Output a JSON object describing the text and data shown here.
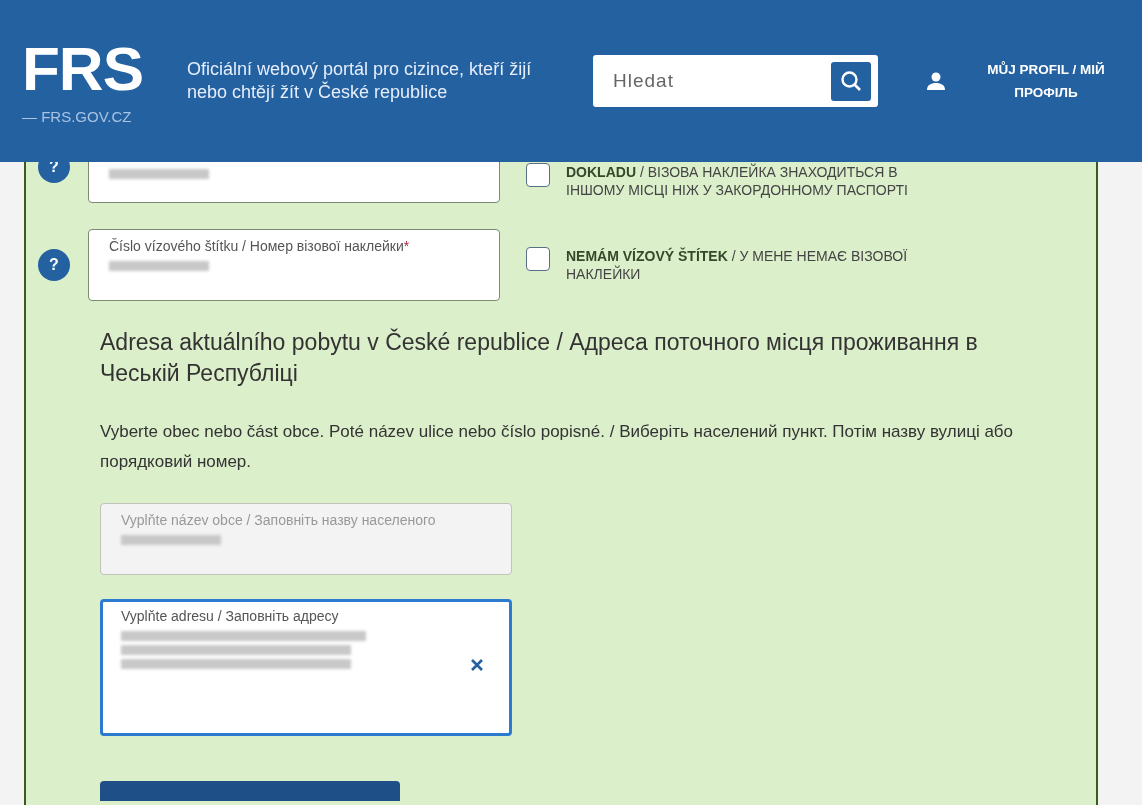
{
  "header": {
    "logo": "FRS",
    "domain": "— FRS.GOV.CZ",
    "tagline": "Oficiální webový portál pro cizince, kteří žijí nebo chtějí žít v České republice",
    "search": {
      "placeholder": "Hledat"
    },
    "profile": "MŮJ PROFIL / МІЙ ПРОФІЛЬ"
  },
  "rows": [
    {
      "help": "?",
      "field": {
        "value_hidden": true,
        "disabled": false,
        "focused": false
      },
      "checkbox": {
        "label": "**DOKLADU** / ВІЗОВА НАКЛЕЙКА ЗНАХОДИТЬСЯ В ІНШОМУ МІСЦІ НІЖ У ЗАКОРДОННОМУ ПАСПОРТІ",
        "checked": false
      }
    },
    {
      "help": "?",
      "field": {
        "label": "Číslo vízového štítku / Номер візової наклейки",
        "required": "*",
        "value_hidden": true,
        "disabled": false,
        "focused": false
      },
      "checkbox": {
        "label": "**NEMÁM VÍZOVÝ ŠTÍTEK** / У МЕНЕ НЕМАЄ ВІЗОВОЇ НАКЛЕЙКИ",
        "checked": false
      }
    }
  ],
  "address": {
    "heading": "Adresa aktuálního pobytu v České republice / Адреса поточного місця проживання в Чеській Республіці",
    "hint": "Vyberte obec nebo část obce. Poté název ulice nebo číslo popisné. / Виберіть населений пункт. Потім назву вулиці або порядковий номер.",
    "fields": [
      {
        "label": "Vyplňte název obce / Заповніть назву населеного",
        "value_hidden": true,
        "disabled": true,
        "focused": false,
        "clear": false
      },
      {
        "label": "Vyplňte adresu / Заповніть адресу",
        "value_hidden": true,
        "disabled": false,
        "focused": true,
        "clear": true
      }
    ]
  }
}
